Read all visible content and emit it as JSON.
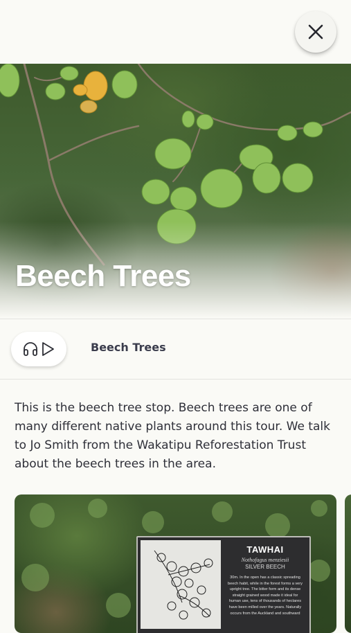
{
  "header": {
    "close_icon": "close-icon"
  },
  "hero": {
    "title": "Beech Trees"
  },
  "audio": {
    "icon": "headphones-play-icon",
    "title": "Beech Trees"
  },
  "description": "This is the beech tree stop. Beech trees are one of many different native plants around this tour. We talk to Jo Smith from the Wakatipu Reforestation Trust about the beech trees in the area.",
  "gallery": {
    "sign": {
      "title": "TAWHAI",
      "scientific_name": "Nothofagus menziesii",
      "common_name": "SILVER BEECH",
      "body": "30m. In the open has a classic spreading beech habit, while in the forest forms a very upright tree. The bitter form and its dense straight grained wood made it ideal for human use, tens of thousands of hectares have been milled over the years. Naturally occurs from the Auckland and southward"
    }
  }
}
